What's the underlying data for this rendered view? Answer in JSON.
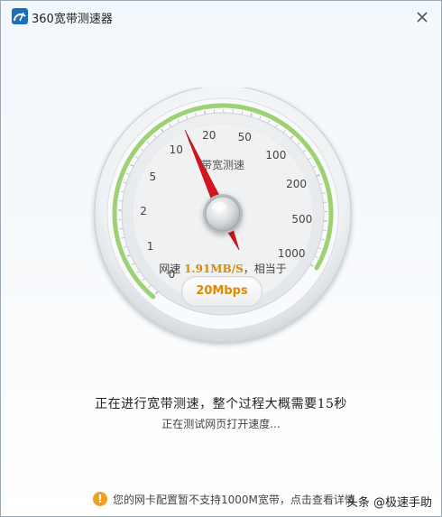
{
  "window": {
    "title": "360宽带测速器",
    "close_icon": "close-icon"
  },
  "gauge": {
    "caption": "带宽测速",
    "scale_labels": [
      "0",
      "1",
      "2",
      "5",
      "10",
      "20",
      "50",
      "100",
      "200",
      "500",
      "1000"
    ],
    "needle_value": "10",
    "speed_prefix": "网速",
    "speed_value": "1.91MB/S",
    "speed_suffix": "，相当于",
    "mbps": "20Mbps",
    "colors": {
      "arc": "#9ed174",
      "needle": "#d8151c",
      "mbps": "#e08a00",
      "speed": "#d88a00"
    }
  },
  "status": {
    "main": "正在进行宽带测速，整个过程大概需要15秒",
    "sub": "正在测试网页打开速度..."
  },
  "footer": {
    "notice": "您的网卡配置暂不支持1000M宽带，点击查看详情",
    "watermark": "头条 @极速手助"
  }
}
